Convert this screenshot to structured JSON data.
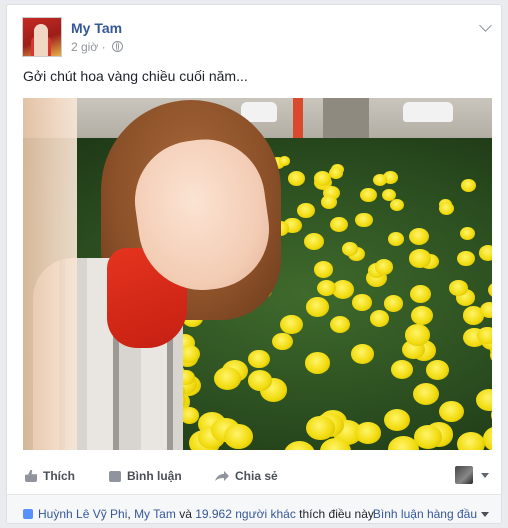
{
  "post": {
    "author": "My Tam",
    "time": "2 giờ",
    "privacy_icon": "globe-icon",
    "text": "Gởi chút hoa vàng chiều cuối năm...",
    "image_alt": "Selfie in front of a bed of yellow chrysanthemums on a street"
  },
  "actions": {
    "like": "Thích",
    "comment": "Bình luận",
    "share": "Chia sẻ"
  },
  "footer": {
    "friend_1": "Huỳnh Lê Vỹ Phi",
    "sep": ", ",
    "friend_2": "My Tam",
    "and": " và ",
    "others": "19.962 người khác",
    "suffix": " thích điều này.",
    "sort_label": "Bình luận hàng đầu"
  },
  "colors": {
    "link": "#365899",
    "muted": "#90949c",
    "accent_red": "#d8352e",
    "flower_yellow": "#f2dc10"
  }
}
